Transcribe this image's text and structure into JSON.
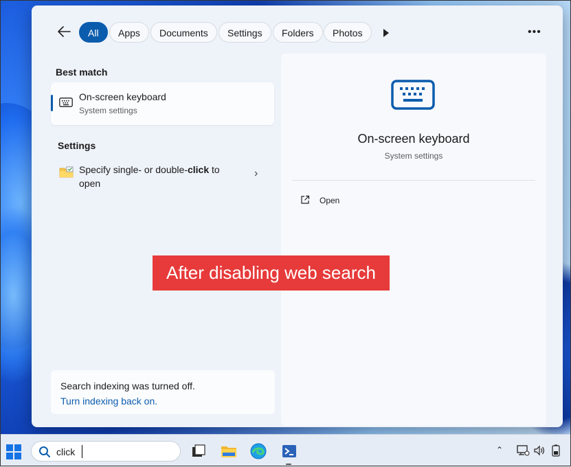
{
  "filters": {
    "tabs": [
      "All",
      "Apps",
      "Documents",
      "Settings",
      "Folders",
      "Photos"
    ],
    "active": "All"
  },
  "left_panel": {
    "best_match_heading": "Best match",
    "best_match": {
      "title": "On-screen keyboard",
      "subtitle": "System settings"
    },
    "settings_heading": "Settings",
    "setting_item": {
      "text_before": "Specify single- or double-",
      "text_bold": "click",
      "text_after": " to open"
    },
    "indexing_notice": "Search indexing was turned off.",
    "indexing_link": "Turn indexing back on."
  },
  "right_panel": {
    "title": "On-screen keyboard",
    "subtitle": "System settings",
    "action_open": "Open"
  },
  "overlay_label": "After disabling web search",
  "taskbar": {
    "search_query": "click"
  },
  "colors": {
    "accent": "#0b5cad",
    "overlay": "#e73a3a"
  }
}
